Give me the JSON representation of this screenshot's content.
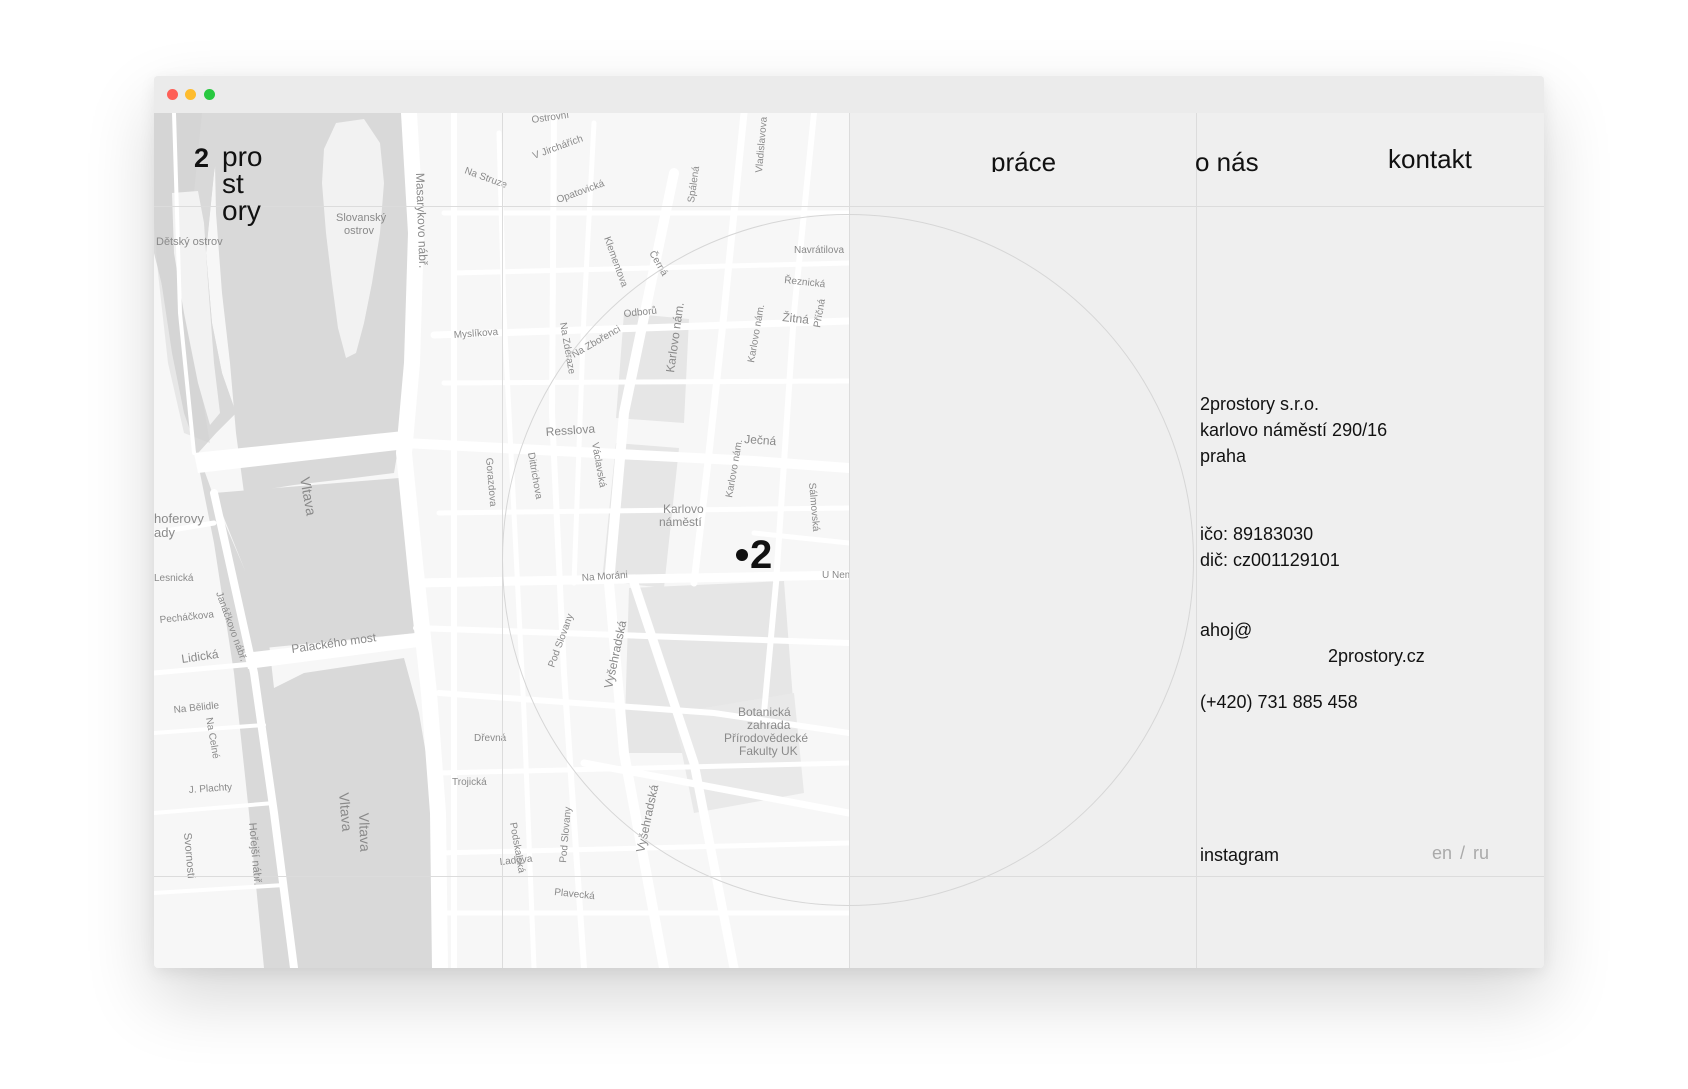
{
  "window": {
    "controls": [
      "close",
      "minimize",
      "maximize"
    ]
  },
  "logo": {
    "mark": "2",
    "lines": [
      "pro",
      "st",
      "ory"
    ]
  },
  "nav": {
    "items": [
      {
        "label": "práce",
        "id": "prace"
      },
      {
        "label": "o nás",
        "id": "o-nas"
      },
      {
        "label": "kontakt",
        "id": "kontakt"
      }
    ]
  },
  "contact": {
    "company": "2prostory s.r.o.",
    "street": "karlovo náměstí 290/16",
    "city": "praha",
    "ico": "ičo: 89183030",
    "dic": "dič: cz001129101",
    "email_user": "ahoj@",
    "email_domain": "2prostory.cz",
    "phone": "(+420) 731 885 458",
    "instagram": "instagram"
  },
  "lang": {
    "en": "en",
    "sep": "/",
    "ru": "ru"
  },
  "map": {
    "pin_label": "2",
    "labels": {
      "vltava1": "Vltava",
      "vltava2": "Vltava",
      "vltava3": "Vltava",
      "detsky": "Dětský ostrov",
      "slovansky1": "Slovanský",
      "slovansky2": "ostrov",
      "masarykovo": "Masarykovo nábř.",
      "resslova": "Resslova",
      "jecna": "Ječná",
      "zitna": "Žitná",
      "karlovo_nam": "Karlovo nám.",
      "karlovo1": "Karlovo",
      "karlovo2": "náměstí",
      "palackeho": "Palackého most",
      "lidicka": "Lidická",
      "vysehradska1": "Vyšehradská",
      "vysehradska2": "Vyšehradská",
      "botanicka1": "Botanická",
      "botanicka2": "zahrada",
      "botanicka3": "Přírodovědecké",
      "botanicka4": "Fakulty UK",
      "na_morani": "Na Moráni",
      "myslikova": "Myslíkova",
      "odboru": "Odborů",
      "navratilova": "Navrátilova",
      "reznicka": "Řeznická",
      "trojicka": "Trojická",
      "ladova": "Ladova",
      "plavecka": "Plavecká",
      "pechackova": "Pecháčkova",
      "na_belidle": "Na Bělidle",
      "plachty": "J. Plachty",
      "svornosti": "Svornosti",
      "horejsi": "Hořejší nábř.",
      "opatovicka": "Opatovická",
      "na_struze": "Na Struze",
      "jirchari": "V Jirchářích",
      "ostrovni": "Ostrovní",
      "pod_slovany1": "Pod Slovany",
      "pod_slovany2": "Pod Slovany",
      "dittrichova": "Dittrichova",
      "gorazdova": "Gorazdova",
      "vaclavska": "Václavská",
      "na_zderaze": "Na Zderaze",
      "na_zborenci": "Na Zbořenci",
      "spalena": "Spálená",
      "cerna": "Černá",
      "klementova": "Klementova",
      "salmovska": "Sálmovská",
      "u_nemocnice": "U Nem",
      "drevna": "Dřevná",
      "podskalska": "Podskalská",
      "lesnicka": "Lesnická",
      "janackovo": "Janáčkovo nábř.",
      "hoferovy1": "hoferovy",
      "hoferovy2": "ady",
      "na_cejle": "Na Celné",
      "pricna": "Příčná",
      "vladislavova": "Vladislavova",
      "karlovo_nam2": "Karlovo nám.",
      "karlovo_nam3": "Karlovo nám.",
      "vyton": "Vyšehradská"
    }
  },
  "colors": {
    "background": "#efefef",
    "map_bg": "#f7f7f7",
    "water": "#d9d9d9",
    "park": "#e6e6e6",
    "road": "#ffffff",
    "text": "#111111",
    "muted": "#aaaaaa",
    "grid": "#dcdcdc"
  }
}
